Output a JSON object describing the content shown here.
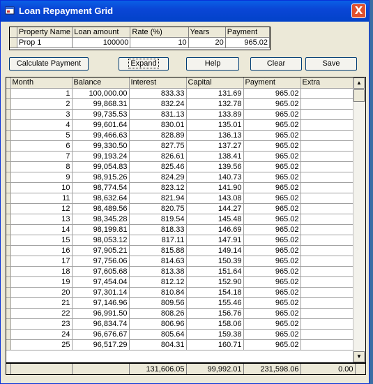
{
  "window": {
    "title": "Loan Repayment Grid",
    "close_label": "X"
  },
  "summary": {
    "headers": [
      "Property Name",
      "Loan amount",
      "Rate (%)",
      "Years",
      "Payment"
    ],
    "row": [
      "Prop 1",
      "100000",
      "10",
      "20",
      "965.02"
    ]
  },
  "buttons": {
    "calculate": "Calculate Payment",
    "expand": "Expand",
    "help": "Help",
    "clear": "Clear",
    "save": "Save"
  },
  "grid": {
    "headers": [
      "Month",
      "Balance",
      "Interest",
      "Capital",
      "Payment",
      "Extra"
    ],
    "rows": [
      [
        "1",
        "100,000.00",
        "833.33",
        "131.69",
        "965.02",
        ""
      ],
      [
        "2",
        "99,868.31",
        "832.24",
        "132.78",
        "965.02",
        ""
      ],
      [
        "3",
        "99,735.53",
        "831.13",
        "133.89",
        "965.02",
        ""
      ],
      [
        "4",
        "99,601.64",
        "830.01",
        "135.01",
        "965.02",
        ""
      ],
      [
        "5",
        "99,466.63",
        "828.89",
        "136.13",
        "965.02",
        ""
      ],
      [
        "6",
        "99,330.50",
        "827.75",
        "137.27",
        "965.02",
        ""
      ],
      [
        "7",
        "99,193.24",
        "826.61",
        "138.41",
        "965.02",
        ""
      ],
      [
        "8",
        "99,054.83",
        "825.46",
        "139.56",
        "965.02",
        ""
      ],
      [
        "9",
        "98,915.26",
        "824.29",
        "140.73",
        "965.02",
        ""
      ],
      [
        "10",
        "98,774.54",
        "823.12",
        "141.90",
        "965.02",
        ""
      ],
      [
        "11",
        "98,632.64",
        "821.94",
        "143.08",
        "965.02",
        ""
      ],
      [
        "12",
        "98,489.56",
        "820.75",
        "144.27",
        "965.02",
        ""
      ],
      [
        "13",
        "98,345.28",
        "819.54",
        "145.48",
        "965.02",
        ""
      ],
      [
        "14",
        "98,199.81",
        "818.33",
        "146.69",
        "965.02",
        ""
      ],
      [
        "15",
        "98,053.12",
        "817.11",
        "147.91",
        "965.02",
        ""
      ],
      [
        "16",
        "97,905.21",
        "815.88",
        "149.14",
        "965.02",
        ""
      ],
      [
        "17",
        "97,756.06",
        "814.63",
        "150.39",
        "965.02",
        ""
      ],
      [
        "18",
        "97,605.68",
        "813.38",
        "151.64",
        "965.02",
        ""
      ],
      [
        "19",
        "97,454.04",
        "812.12",
        "152.90",
        "965.02",
        ""
      ],
      [
        "20",
        "97,301.14",
        "810.84",
        "154.18",
        "965.02",
        ""
      ],
      [
        "21",
        "97,146.96",
        "809.56",
        "155.46",
        "965.02",
        ""
      ],
      [
        "22",
        "96,991.50",
        "808.26",
        "156.76",
        "965.02",
        ""
      ],
      [
        "23",
        "96,834.74",
        "806.96",
        "158.06",
        "965.02",
        ""
      ],
      [
        "24",
        "96,676.67",
        "805.64",
        "159.38",
        "965.02",
        ""
      ],
      [
        "25",
        "96,517.29",
        "804.31",
        "160.71",
        "965.02",
        ""
      ]
    ],
    "totals": [
      "",
      "",
      "131,606.05",
      "99,992.01",
      "231,598.06",
      "0.00"
    ]
  },
  "scrollbar": {
    "up_glyph": "▲",
    "down_glyph": "▼"
  }
}
